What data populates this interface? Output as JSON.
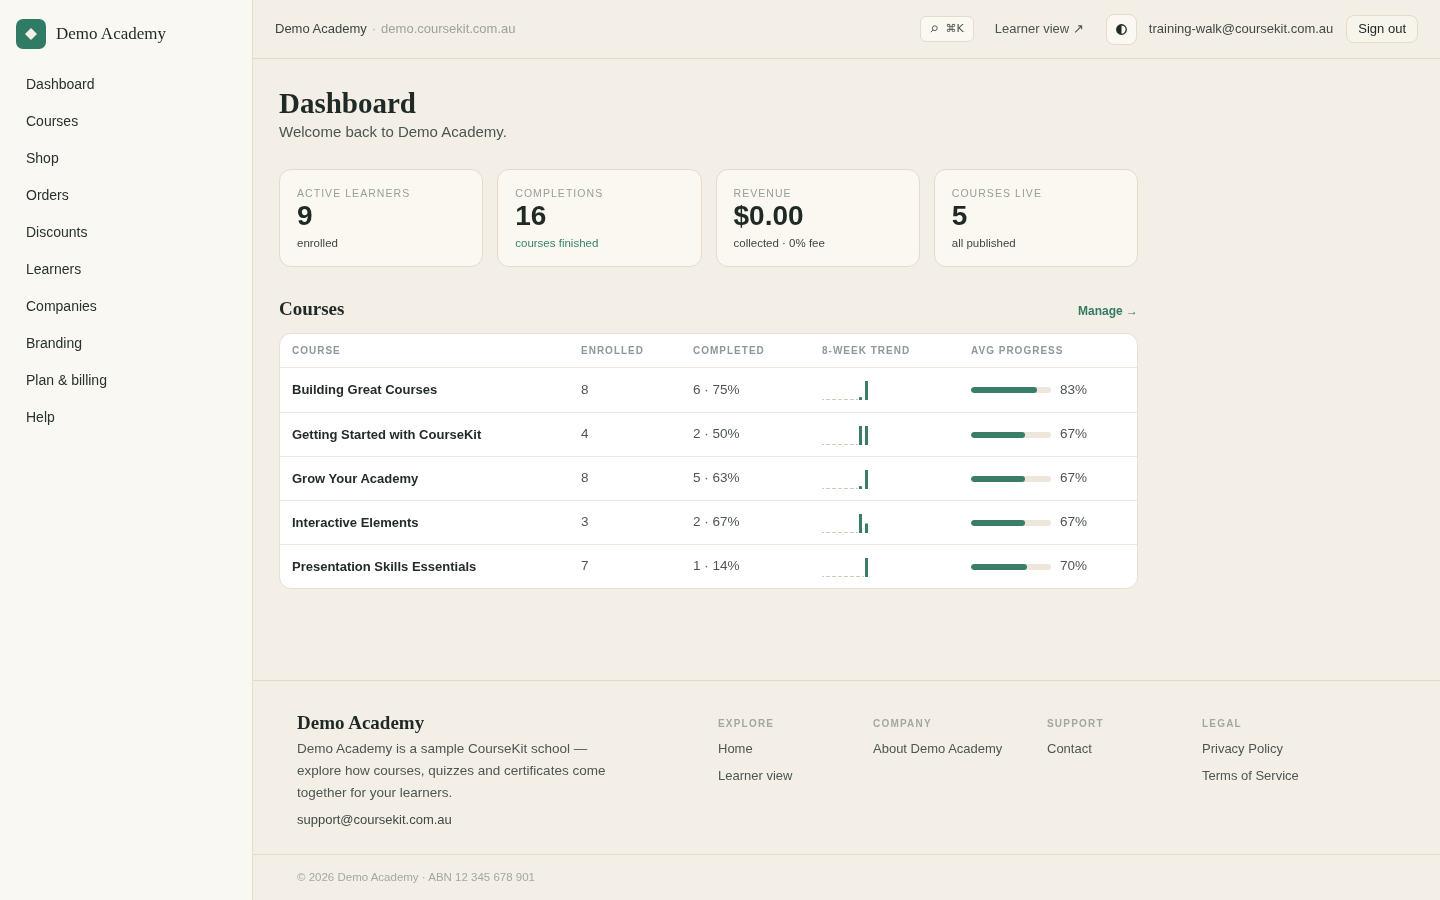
{
  "sidebar": {
    "brand": "Demo Academy",
    "items": [
      "Dashboard",
      "Courses",
      "Shop",
      "Orders",
      "Discounts",
      "Learners",
      "Companies",
      "Branding",
      "Plan & billing",
      "Help"
    ]
  },
  "header": {
    "school": "Demo Academy",
    "separator": "·",
    "domain": "demo.coursekit.com.au",
    "shortcut": "⌘K",
    "learner_view": "Learner view ↗",
    "email": "training-walk@coursekit.com.au",
    "sign_out": "Sign out"
  },
  "page": {
    "title": "Dashboard",
    "subtitle": "Welcome back to Demo Academy."
  },
  "stats": [
    {
      "label": "ACTIVE LEARNERS",
      "value": "9",
      "note": "enrolled",
      "color": "#3f4843"
    },
    {
      "label": "COMPLETIONS",
      "value": "16",
      "note": "courses finished",
      "color": "#3d8368"
    },
    {
      "label": "REVENUE",
      "value": "$0.00",
      "note": "collected · 0% fee",
      "color": "#3f4843"
    },
    {
      "label": "COURSES LIVE",
      "value": "5",
      "note": "all published",
      "color": "#3f4843"
    }
  ],
  "courses": {
    "title": "Courses",
    "manage": "Manage →",
    "columns": [
      "COURSE",
      "ENROLLED",
      "COMPLETED",
      "8-WEEK TREND",
      "AVG PROGRESS"
    ],
    "rows": [
      {
        "course": "Building Great Courses",
        "enrolled": "8",
        "completed": "6 · 75%",
        "level": 0.83,
        "progress": "83%"
      },
      {
        "course": "Getting Started with CourseKit",
        "enrolled": "4",
        "completed": "2 · 50%",
        "level": 0.67,
        "progress": "67%"
      },
      {
        "course": "Grow Your Academy",
        "enrolled": "8",
        "completed": "5 · 63%",
        "level": 0.67,
        "progress": "67%"
      },
      {
        "course": "Interactive Elements",
        "enrolled": "3",
        "completed": "2 · 67%",
        "level": 0.67,
        "progress": "67%"
      },
      {
        "course": "Presentation Skills Essentials",
        "enrolled": "7",
        "completed": "1 · 14%",
        "level": 0.7,
        "progress": "70%"
      }
    ]
  },
  "footer": {
    "brand": "Demo Academy",
    "about": "Demo Academy is a sample CourseKit school — explore how courses, quizzes and certificates come together for your learners.",
    "email": "support@coursekit.com.au",
    "columns": [
      {
        "heading": "EXPLORE",
        "links": [
          "Home",
          "Learner view"
        ]
      },
      {
        "heading": "COMPANY",
        "links": [
          "About Demo Academy"
        ]
      },
      {
        "heading": "SUPPORT",
        "links": [
          "Contact"
        ]
      },
      {
        "heading": "LEGAL",
        "links": [
          "Privacy Policy",
          "Terms of Service"
        ]
      }
    ],
    "copyright": "© 2026 Demo Academy · ABN 12 345 678 901"
  }
}
